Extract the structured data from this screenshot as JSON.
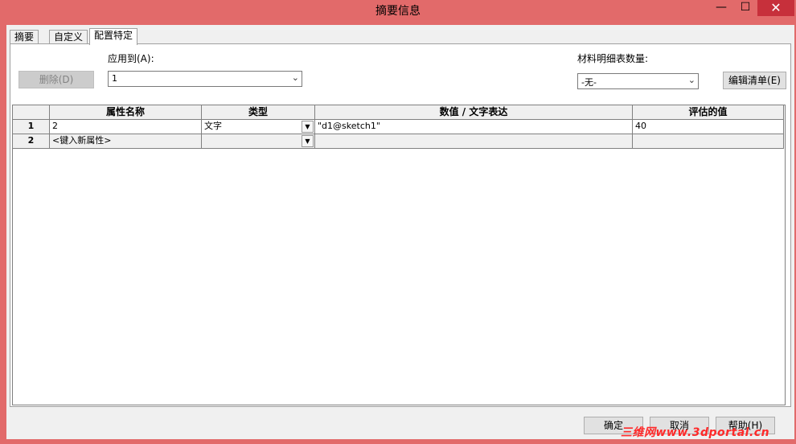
{
  "window": {
    "title": "摘要信息",
    "minimize": "—",
    "maximize": "☐",
    "close": "✕"
  },
  "tabs": [
    {
      "label": "摘要"
    },
    {
      "label": "自定义"
    },
    {
      "label": "配置特定"
    }
  ],
  "toolbar": {
    "delete_label": "删除(D)",
    "apply_to_label": "应用到(A):",
    "apply_to_value": "1",
    "bom_qty_label": "材料明细表数量:",
    "bom_qty_value": "-无-",
    "edit_list_label": "编辑清单(E)"
  },
  "table": {
    "headers": [
      "属性名称",
      "类型",
      "数值 / 文字表达",
      "评估的值"
    ],
    "rows": [
      {
        "index": "1",
        "name": "2",
        "type": "文字",
        "value": "\"d1@sketch1\"",
        "evaluated": "40"
      },
      {
        "index": "2",
        "name": "<键入新属性>",
        "type": "",
        "value": "",
        "evaluated": ""
      }
    ]
  },
  "footer": {
    "ok": "确定",
    "cancel": "取消",
    "help": "帮助(H)"
  },
  "watermark": "三维网www.3dportal.cn",
  "icons": {
    "dropdown": "chevron-down-icon"
  },
  "colors": {
    "titlebar": "#e26a6a",
    "close": "#c7303b"
  }
}
